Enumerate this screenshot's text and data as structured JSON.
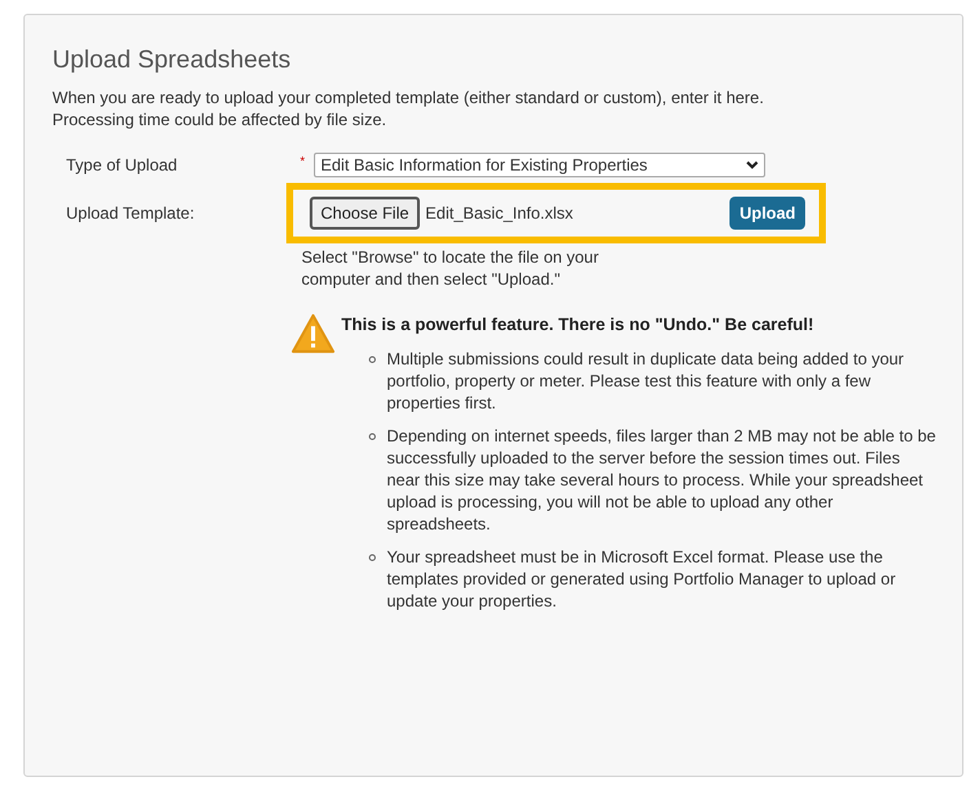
{
  "panel": {
    "title": "Upload Spreadsheets",
    "description_lines": [
      "When you are ready to upload your completed template (either standard or custom), enter it here.",
      "Processing time could be affected by file size."
    ]
  },
  "form": {
    "type_label": "Type of Upload",
    "required_mark": "*",
    "type_value": "Edit Basic Information for Existing Properties",
    "template_label": "Upload Template:",
    "choose_file_button": "Choose File",
    "file_name": "Edit_Basic_Info.xlsx",
    "upload_button": "Upload",
    "help_lines": [
      "Select \"Browse\" to locate the file on your",
      "computer and then select \"Upload.\""
    ]
  },
  "warning": {
    "heading": "This is a powerful feature. There is no \"Undo.\" Be careful!",
    "items": [
      "Multiple submissions could result in duplicate data being added to your portfolio, property or meter. Please test this feature with only a few properties first.",
      "Depending on internet speeds, files larger than 2 MB may not be able to be successfully uploaded to the server before the session times out. Files near this size may take several hours to process. While your spreadsheet upload is processing, you will not be able to upload any other spreadsheets.",
      "Your spreadsheet must be in Microsoft Excel format. Please use the templates provided or generated using Portfolio Manager to upload or update your properties."
    ]
  }
}
